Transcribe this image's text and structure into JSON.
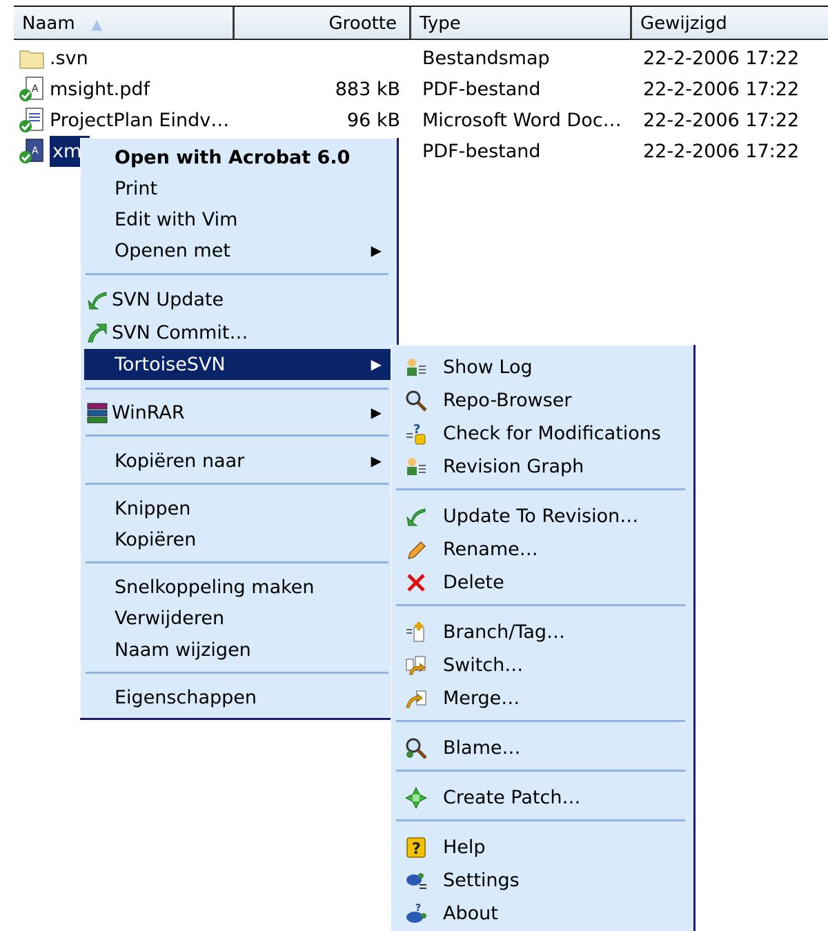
{
  "columns": {
    "name": "Naam",
    "size": "Grootte",
    "type": "Type",
    "modified": "Gewijzigd"
  },
  "files": [
    {
      "name": ".svn",
      "size": "",
      "type": "Bestandsmap",
      "modified": "22-2-2006 17:22",
      "icon": "folder-icon"
    },
    {
      "name": "msight.pdf",
      "size": "883 kB",
      "type": "PDF-bestand",
      "modified": "22-2-2006 17:22",
      "icon": "pdf-svn-icon"
    },
    {
      "name": "ProjectPlan Eindv…",
      "size": "96 kB",
      "type": "Microsoft Word Doc…",
      "modified": "22-2-2006 17:22",
      "icon": "word-svn-icon"
    },
    {
      "name": "xml",
      "size": "",
      "type": "PDF-bestand",
      "modified": "22-2-2006 17:22",
      "icon": "pdf-svn-icon",
      "selected": true
    }
  ],
  "context_menu": {
    "open_with_acrobat": "Open with Acrobat 6.0",
    "print": "Print",
    "edit_with_vim": "Edit with Vim",
    "open_with": "Openen met",
    "svn_update": "SVN Update",
    "svn_commit": "SVN Commit…",
    "tortoisesvn": "TortoiseSVN",
    "winrar": "WinRAR",
    "copy_to": "Kopiëren naar",
    "cut": "Knippen",
    "copy": "Kopiëren",
    "create_shortcut": "Snelkoppeling maken",
    "delete": "Verwijderen",
    "rename": "Naam wijzigen",
    "properties": "Eigenschappen"
  },
  "tortoise_menu": {
    "show_log": "Show Log",
    "repo_browser": "Repo-Browser",
    "check_modifications": "Check for Modifications",
    "revision_graph": "Revision Graph",
    "update_to_revision": "Update To Revision…",
    "rename": "Rename…",
    "delete": "Delete",
    "branch_tag": "Branch/Tag…",
    "switch": "Switch…",
    "merge": "Merge…",
    "blame": "Blame…",
    "create_patch": "Create Patch…",
    "help": "Help",
    "settings": "Settings",
    "about": "About"
  },
  "colors": {
    "menu_bg": "#d9ebfb",
    "highlight": "#0a246a",
    "separator": "#8fb4e3"
  }
}
